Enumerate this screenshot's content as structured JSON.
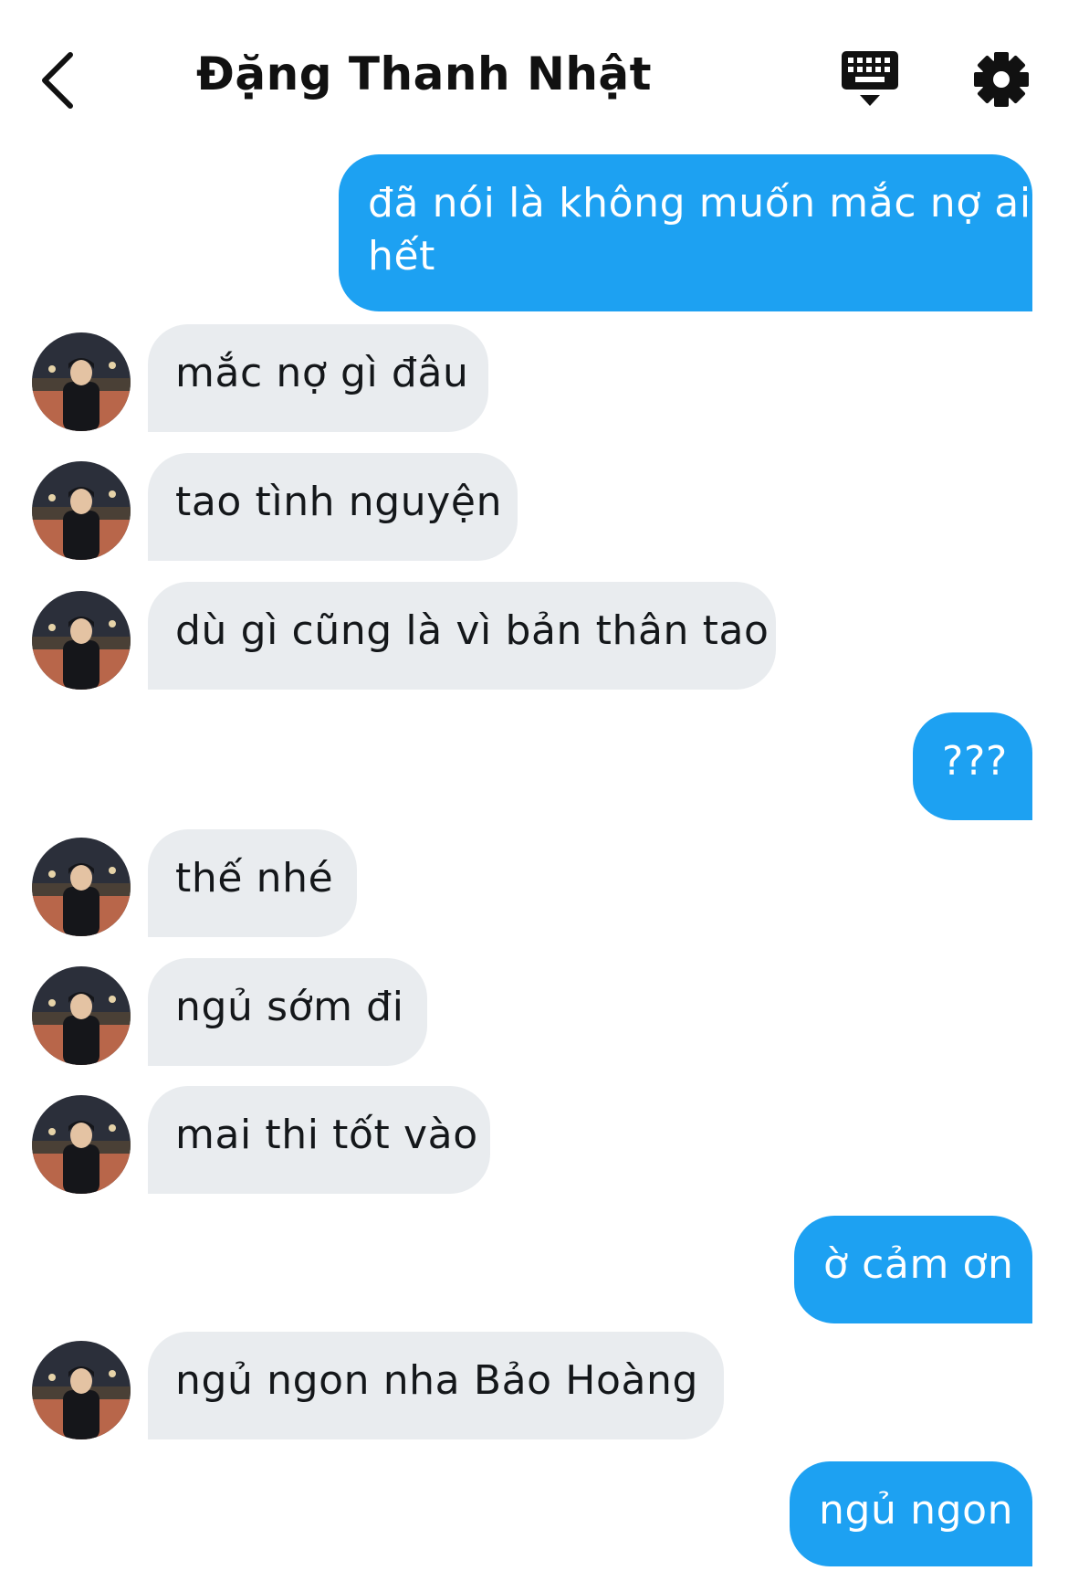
{
  "header": {
    "title": "Đặng Thanh Nhật",
    "back_icon": "chevron-left-icon",
    "keyboard_icon": "keyboard-icon",
    "settings_icon": "gear-icon"
  },
  "colors": {
    "outgoing_bubble": "#1da1f2",
    "incoming_bubble": "#e9ecef"
  },
  "messages": [
    {
      "side": "out",
      "text_lines": [
        "đã nói là không muốn mắc nợ ai",
        "hết"
      ]
    },
    {
      "side": "in",
      "text": "mắc nợ gì đâu"
    },
    {
      "side": "in",
      "text": "tao tình nguyện"
    },
    {
      "side": "in",
      "text": "dù gì cũng là vì bản thân tao"
    },
    {
      "side": "out",
      "text": "???"
    },
    {
      "side": "in",
      "text": "thế nhé"
    },
    {
      "side": "in",
      "text": "ngủ sớm đi"
    },
    {
      "side": "in",
      "text": "mai thi tốt vào"
    },
    {
      "side": "out",
      "text": "ờ cảm ơn"
    },
    {
      "side": "in",
      "text": "ngủ ngon nha Bảo Hoàng"
    },
    {
      "side": "out",
      "text": "ngủ ngon"
    }
  ]
}
